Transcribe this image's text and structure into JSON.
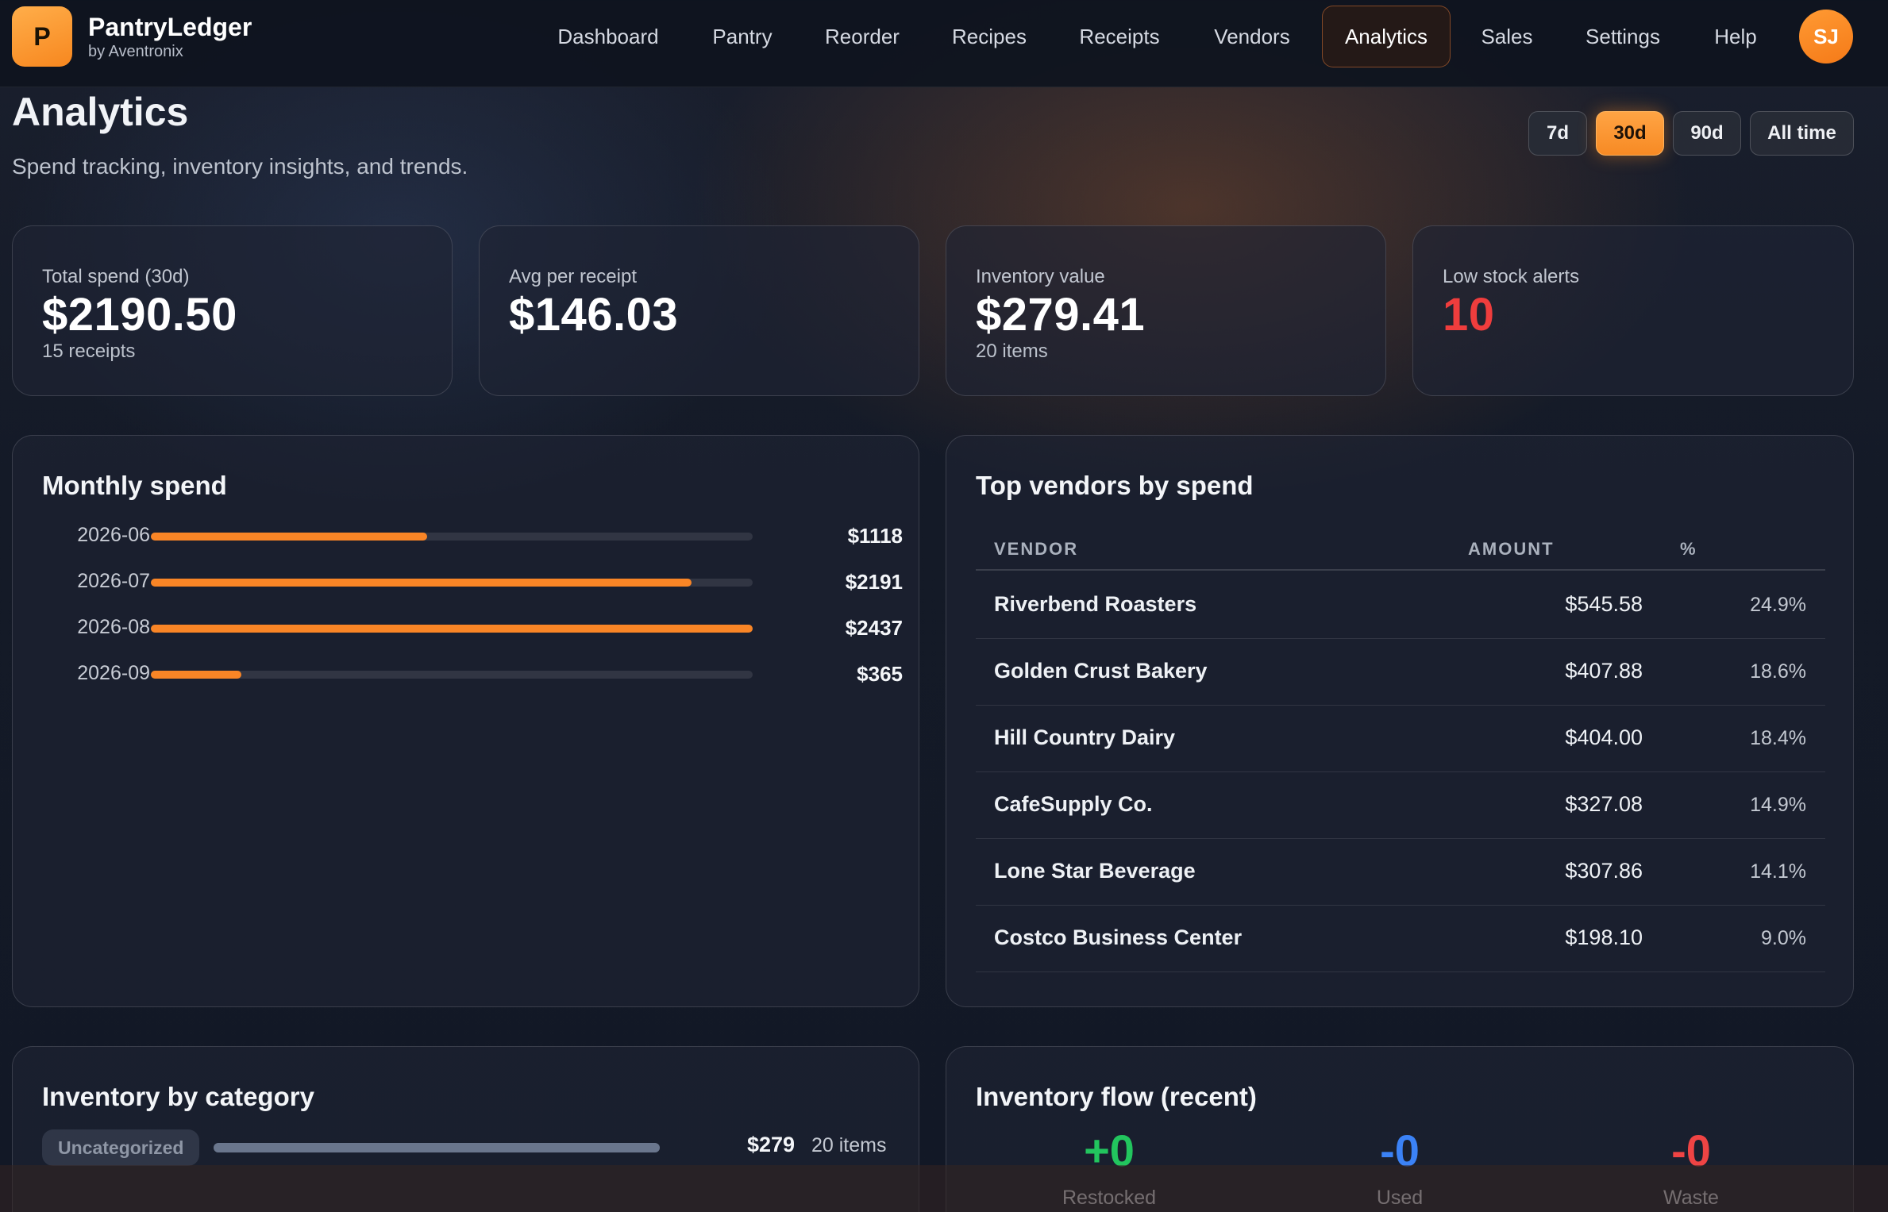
{
  "brand": {
    "logo_letter": "P",
    "name": "PantryLedger",
    "sub": "by Aventronix"
  },
  "nav": [
    {
      "label": "Dashboard"
    },
    {
      "label": "Pantry"
    },
    {
      "label": "Reorder"
    },
    {
      "label": "Recipes"
    },
    {
      "label": "Receipts"
    },
    {
      "label": "Vendors"
    },
    {
      "label": "Analytics",
      "active": true
    },
    {
      "label": "Sales"
    },
    {
      "label": "Settings"
    },
    {
      "label": "Help"
    }
  ],
  "user": {
    "initials": "SJ"
  },
  "page": {
    "title": "Analytics",
    "subtitle": "Spend tracking, inventory insights, and trends."
  },
  "ranges": [
    {
      "label": "7d"
    },
    {
      "label": "30d",
      "active": true
    },
    {
      "label": "90d"
    },
    {
      "label": "All time"
    }
  ],
  "stats": {
    "total_spend": {
      "label": "Total spend (30d)",
      "value": "$2190.50",
      "sub": "15 receipts"
    },
    "avg_receipt": {
      "label": "Avg per receipt",
      "value": "$146.03"
    },
    "inventory_value": {
      "label": "Inventory value",
      "value": "$279.41",
      "sub": "20 items"
    },
    "low_stock": {
      "label": "Low stock alerts",
      "value": "10"
    }
  },
  "monthly_spend": {
    "title": "Monthly spend",
    "rows": [
      {
        "month": "2026-06",
        "value_label": "$1118",
        "value": 1118
      },
      {
        "month": "2026-07",
        "value_label": "$2191",
        "value": 2191
      },
      {
        "month": "2026-08",
        "value_label": "$2437",
        "value": 2437
      },
      {
        "month": "2026-09",
        "value_label": "$365",
        "value": 365
      }
    ]
  },
  "top_vendors": {
    "title": "Top vendors by spend",
    "headers": {
      "vendor": "VENDOR",
      "amount": "AMOUNT",
      "pct": "%"
    },
    "rows": [
      {
        "vendor": "Riverbend Roasters",
        "amount": "$545.58",
        "pct": "24.9%"
      },
      {
        "vendor": "Golden Crust Bakery",
        "amount": "$407.88",
        "pct": "18.6%"
      },
      {
        "vendor": "Hill Country Dairy",
        "amount": "$404.00",
        "pct": "18.4%"
      },
      {
        "vendor": "CafeSupply Co.",
        "amount": "$327.08",
        "pct": "14.9%"
      },
      {
        "vendor": "Lone Star Beverage",
        "amount": "$307.86",
        "pct": "14.1%"
      },
      {
        "vendor": "Costco Business Center",
        "amount": "$198.10",
        "pct": "9.0%"
      }
    ]
  },
  "inventory_category": {
    "title": "Inventory by category",
    "rows": [
      {
        "name": "Uncategorized",
        "value": "$279",
        "count": "20 items",
        "share": 1.0
      }
    ]
  },
  "inventory_flow": {
    "title": "Inventory flow (recent)",
    "restocked": {
      "value": "+0",
      "label": "Restocked",
      "color": "#22c55e"
    },
    "used": {
      "value": "-0",
      "label": "Used",
      "color": "#3b82f6"
    },
    "waste": {
      "value": "-0",
      "label": "Waste",
      "color": "#ef4444"
    }
  }
}
